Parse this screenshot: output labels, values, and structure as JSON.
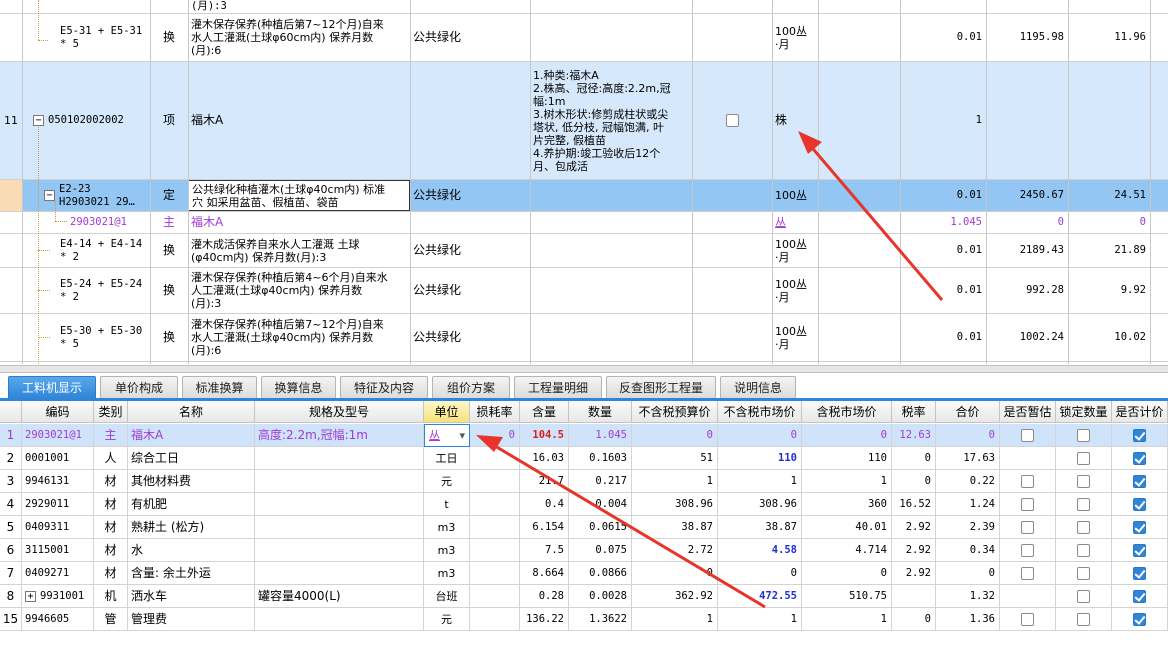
{
  "top_grid": {
    "rows": [
      {
        "rownum": "",
        "code": "(月):3",
        "type": "",
        "name": "",
        "spec": "",
        "feature": "",
        "unit": "",
        "qty": "",
        "price": "",
        "total": ""
      },
      {
        "rownum": "",
        "code": "E5-31 + E5-31\n* 5",
        "type": "换",
        "name": "灌木保存保养(种植后第7~12个月)自来\n水人工灌溉(土球φ60cm内) 保养月数\n(月):6",
        "spec": "公共绿化",
        "feature": "",
        "unit": "100丛\n·月",
        "qty": "0.01",
        "price": "1195.98",
        "total": "11.96"
      },
      {
        "rownum": "11",
        "code": "050102002002",
        "type": "项",
        "name": "福木A",
        "spec": "",
        "feature": "1.种类:福木A\n2.株高、冠径:高度:2.2m,冠\n幅:1m\n3.树木形状:修剪成柱状或尖\n塔状, 低分枝, 冠幅饱满, 叶\n片完整, 假植苗\n4.养护期:竣工验收后12个\n月、包成活",
        "unit": "株",
        "qty": "1",
        "price": "",
        "total": ""
      },
      {
        "rownum": "",
        "code": "E2-23\nH2903021 29…",
        "type": "定",
        "name": "公共绿化种植灌木(土球φ40cm内) 标准\n穴 如采用盆苗、假植苗、袋苗",
        "spec": "公共绿化",
        "feature": "",
        "unit": "100丛",
        "qty": "0.01",
        "price": "2450.67",
        "total": "24.51"
      },
      {
        "rownum": "",
        "code": "2903021@1",
        "type": "主",
        "name": "福木A",
        "spec": "",
        "feature": "",
        "unit": "丛",
        "qty": "1.045",
        "price": "0",
        "total": "0"
      },
      {
        "rownum": "",
        "code": "E4-14 + E4-14\n* 2",
        "type": "换",
        "name": "灌木成活保养自来水人工灌溉 土球\n(φ40cm内) 保养月数(月):3",
        "spec": "公共绿化",
        "feature": "",
        "unit": "100丛\n·月",
        "qty": "0.01",
        "price": "2189.43",
        "total": "21.89"
      },
      {
        "rownum": "",
        "code": "E5-24 + E5-24\n* 2",
        "type": "换",
        "name": "灌木保存保养(种植后第4~6个月)自来水\n人工灌溉(土球φ40cm内) 保养月数\n(月):3",
        "spec": "公共绿化",
        "feature": "",
        "unit": "100丛\n·月",
        "qty": "0.01",
        "price": "992.28",
        "total": "9.92"
      },
      {
        "rownum": "",
        "code": "E5-30 + E5-30\n* 5",
        "type": "换",
        "name": "灌木保存保养(种植后第7~12个月)自来\n水人工灌溉(土球φ40cm内) 保养月数\n(月):6",
        "spec": "公共绿化",
        "feature": "",
        "unit": "100丛\n·月",
        "qty": "0.01",
        "price": "1002.24",
        "total": "10.02"
      }
    ]
  },
  "tabs": [
    "工料机显示",
    "单价构成",
    "标准换算",
    "换算信息",
    "特征及内容",
    "组价方案",
    "工程量明细",
    "反查图形工程量",
    "说明信息"
  ],
  "columns": [
    "编码",
    "类别",
    "名称",
    "规格及型号",
    "单位",
    "损耗率",
    "含量",
    "数量",
    "不含税预算价",
    "不含税市场价",
    "含税市场价",
    "税率",
    "合价",
    "是否暂估",
    "锁定数量",
    "是否计价"
  ],
  "bottom_rows": [
    {
      "no": "1",
      "code": "2903021@1",
      "cat": "主",
      "name": "福木A",
      "spec": "高度:2.2m,冠幅:1m",
      "unit": "丛",
      "loss": "0",
      "content": "104.5",
      "qty": "1.045",
      "budget": "0",
      "market": "0",
      "taxmarket": "0",
      "rate": "12.63",
      "total": "0",
      "est": "box",
      "lock": "box",
      "priced": "on"
    },
    {
      "no": "2",
      "code": "0001001",
      "cat": "人",
      "name": "综合工日",
      "spec": "",
      "unit": "工日",
      "loss": "",
      "content": "16.03",
      "qty": "0.1603",
      "budget": "51",
      "market": "110",
      "taxmarket": "110",
      "rate": "0",
      "total": "17.63",
      "est": "",
      "lock": "box",
      "priced": "on"
    },
    {
      "no": "3",
      "code": "9946131",
      "cat": "材",
      "name": "其他材料费",
      "spec": "",
      "unit": "元",
      "loss": "",
      "content": "21.7",
      "qty": "0.217",
      "budget": "1",
      "market": "1",
      "taxmarket": "1",
      "rate": "0",
      "total": "0.22",
      "est": "box",
      "lock": "box",
      "priced": "on"
    },
    {
      "no": "4",
      "code": "2929011",
      "cat": "材",
      "name": "有机肥",
      "spec": "",
      "unit": "t",
      "loss": "",
      "content": "0.4",
      "qty": "0.004",
      "budget": "308.96",
      "market": "308.96",
      "taxmarket": "360",
      "rate": "16.52",
      "total": "1.24",
      "est": "box",
      "lock": "box",
      "priced": "on"
    },
    {
      "no": "5",
      "code": "0409311",
      "cat": "材",
      "name": "熟耕土 (松方)",
      "spec": "",
      "unit": "m3",
      "loss": "",
      "content": "6.154",
      "qty": "0.0615",
      "budget": "38.87",
      "market": "38.87",
      "taxmarket": "40.01",
      "rate": "2.92",
      "total": "2.39",
      "est": "box",
      "lock": "box",
      "priced": "on"
    },
    {
      "no": "6",
      "code": "3115001",
      "cat": "材",
      "name": "水",
      "spec": "",
      "unit": "m3",
      "loss": "",
      "content": "7.5",
      "qty": "0.075",
      "budget": "2.72",
      "market": "4.58",
      "taxmarket": "4.714",
      "rate": "2.92",
      "total": "0.34",
      "est": "box",
      "lock": "box",
      "priced": "on"
    },
    {
      "no": "7",
      "code": "0409271",
      "cat": "材",
      "name": "含量: 余土外运",
      "spec": "",
      "unit": "m3",
      "loss": "",
      "content": "8.664",
      "qty": "0.0866",
      "budget": "0",
      "market": "0",
      "taxmarket": "0",
      "rate": "2.92",
      "total": "0",
      "est": "box",
      "lock": "box",
      "priced": "on"
    },
    {
      "no": "8",
      "code": "9931001",
      "cat": "机",
      "name": "洒水车",
      "spec": "罐容量4000(L)",
      "unit": "台班",
      "loss": "",
      "content": "0.28",
      "qty": "0.0028",
      "budget": "362.92",
      "market": "472.55",
      "taxmarket": "510.75",
      "rate": "",
      "total": "1.32",
      "est": "",
      "lock": "box",
      "priced": "on"
    },
    {
      "no": "15",
      "code": "9946605",
      "cat": "管",
      "name": "管理费",
      "spec": "",
      "unit": "元",
      "loss": "",
      "content": "136.22",
      "qty": "1.3622",
      "budget": "1",
      "market": "1",
      "taxmarket": "1",
      "rate": "0",
      "total": "1.36",
      "est": "box",
      "lock": "box",
      "priced": "on"
    }
  ],
  "colors": {
    "accent": "#2f86d8",
    "selected_row": "#cfe3fb",
    "highlight_row": "#8fc3f3",
    "purple": "#a13bd0",
    "red_arrow": "#e8342a"
  }
}
